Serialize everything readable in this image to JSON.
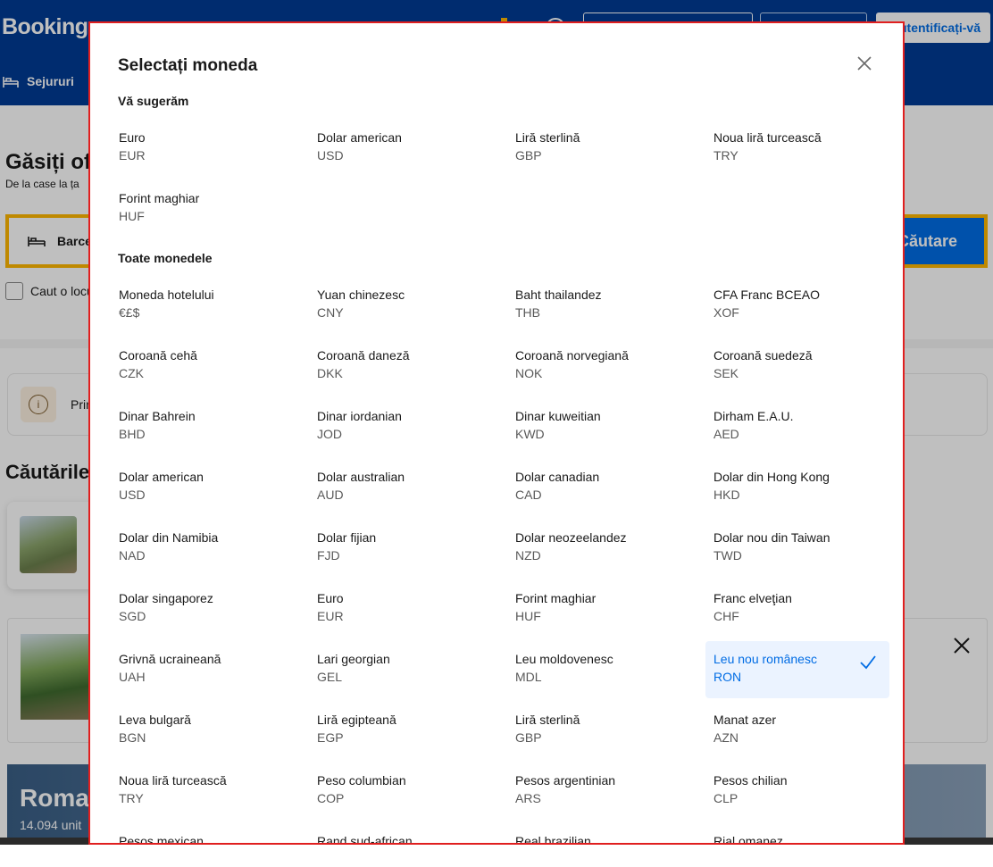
{
  "page": {
    "logo": "Booking.",
    "login_label": "Autentificați-vă",
    "nav_sejururi": "Sejururi",
    "hero_title": "Găsiți ofe",
    "hero_sub": "De la case la ța",
    "search_destination": "Barcel",
    "search_button": "Căutare",
    "checkbox_label": "Caut o locu",
    "info_text": "Prin",
    "recent_title": "Căutările",
    "banner_title": "Roma",
    "banner_sub": "14.094 unit"
  },
  "modal": {
    "title": "Selectați moneda",
    "suggested_title": "Vă sugerăm",
    "all_title": "Toate monedele",
    "suggested": [
      {
        "name": "Euro",
        "code": "EUR"
      },
      {
        "name": "Dolar american",
        "code": "USD"
      },
      {
        "name": "Liră sterlină",
        "code": "GBP"
      },
      {
        "name": "Noua liră turcească",
        "code": "TRY"
      },
      {
        "name": "Forint maghiar",
        "code": "HUF"
      }
    ],
    "all": [
      {
        "name": "Moneda hotelului",
        "code": "€£$"
      },
      {
        "name": "Yuan chinezesc",
        "code": "CNY"
      },
      {
        "name": "Baht thailandez",
        "code": "THB"
      },
      {
        "name": "CFA Franc BCEAO",
        "code": "XOF"
      },
      {
        "name": "Coroană cehă",
        "code": "CZK"
      },
      {
        "name": "Coroană daneză",
        "code": "DKK"
      },
      {
        "name": "Coroană norvegiană",
        "code": "NOK"
      },
      {
        "name": "Coroană suedeză",
        "code": "SEK"
      },
      {
        "name": "Dinar Bahrein",
        "code": "BHD"
      },
      {
        "name": "Dinar iordanian",
        "code": "JOD"
      },
      {
        "name": "Dinar kuweitian",
        "code": "KWD"
      },
      {
        "name": "Dirham E.A.U.",
        "code": "AED"
      },
      {
        "name": "Dolar american",
        "code": "USD"
      },
      {
        "name": "Dolar australian",
        "code": "AUD"
      },
      {
        "name": "Dolar canadian",
        "code": "CAD"
      },
      {
        "name": "Dolar din Hong Kong",
        "code": "HKD"
      },
      {
        "name": "Dolar din Namibia",
        "code": "NAD"
      },
      {
        "name": "Dolar fijian",
        "code": "FJD"
      },
      {
        "name": "Dolar neozeelandez",
        "code": "NZD"
      },
      {
        "name": "Dolar nou din Taiwan",
        "code": "TWD"
      },
      {
        "name": "Dolar singaporez",
        "code": "SGD"
      },
      {
        "name": "Euro",
        "code": "EUR"
      },
      {
        "name": "Forint maghiar",
        "code": "HUF"
      },
      {
        "name": "Franc elveţian",
        "code": "CHF"
      },
      {
        "name": "Grivnă ucraineană",
        "code": "UAH"
      },
      {
        "name": "Lari georgian",
        "code": "GEL"
      },
      {
        "name": "Leu moldovenesc",
        "code": "MDL"
      },
      {
        "name": "Leu nou românesc",
        "code": "RON",
        "selected": true
      },
      {
        "name": "Leva bulgară",
        "code": "BGN"
      },
      {
        "name": "Liră egipteană",
        "code": "EGP"
      },
      {
        "name": "Liră sterlină",
        "code": "GBP"
      },
      {
        "name": "Manat azer",
        "code": "AZN"
      },
      {
        "name": "Noua liră turcească",
        "code": "TRY"
      },
      {
        "name": "Peso columbian",
        "code": "COP"
      },
      {
        "name": "Pesos argentinian",
        "code": "ARS"
      },
      {
        "name": "Pesos chilian",
        "code": "CLP"
      },
      {
        "name": "Pesos mexican",
        "code": ""
      },
      {
        "name": "Rand sud-african",
        "code": ""
      },
      {
        "name": "Real brazilian",
        "code": ""
      },
      {
        "name": "Rial omanez",
        "code": ""
      }
    ],
    "colors": {
      "accent": "#006ce4",
      "selected_bg": "#ebf3ff",
      "header_bg": "#003b95",
      "modal_border": "#e01f1f"
    }
  }
}
